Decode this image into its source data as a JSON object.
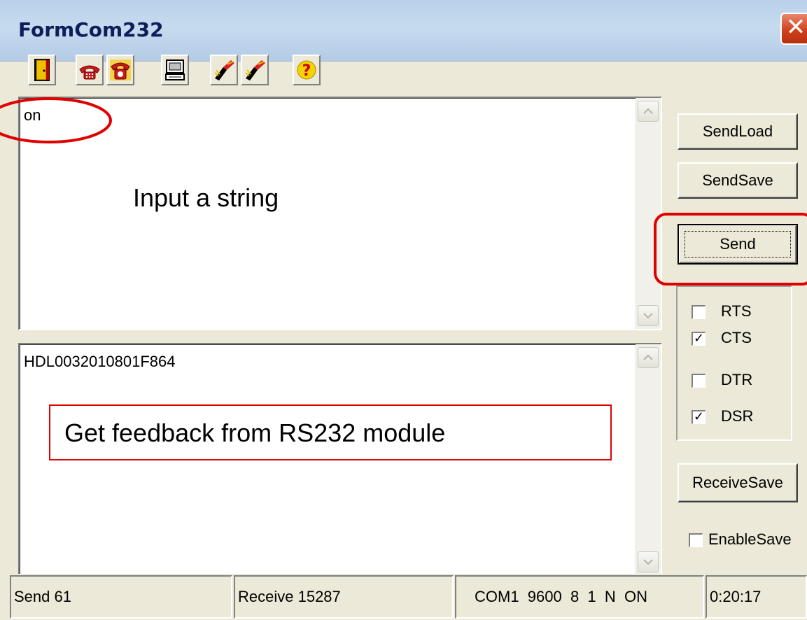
{
  "window": {
    "title": "FormCom232",
    "close_glyph": "✕"
  },
  "toolbar": {
    "buttons": [
      {
        "icon": "exit-door-icon"
      },
      {
        "icon": "telephone-hangup-icon"
      },
      {
        "icon": "telephone-dial-icon"
      },
      {
        "icon": "computer-terminal-icon"
      },
      {
        "icon": "clear-send-icon"
      },
      {
        "icon": "clear-receive-icon"
      },
      {
        "icon": "help-icon",
        "glyph": "?"
      }
    ]
  },
  "send_memo": {
    "value": "on"
  },
  "receive_memo": {
    "value": "HDL0032010801F864"
  },
  "annotations": {
    "input_hint": "Input a string",
    "feedback_hint": "Get feedback from RS232 module",
    "highlight_color": "#e00000"
  },
  "buttons": {
    "send_load": "SendLoad",
    "send_save": "SendSave",
    "send": "Send",
    "receive_save": "ReceiveSave"
  },
  "signals": [
    {
      "label": "RTS",
      "checked": false
    },
    {
      "label": "CTS",
      "checked": true
    },
    {
      "label": "DTR",
      "checked": false
    },
    {
      "label": "DSR",
      "checked": true
    }
  ],
  "enable_save": {
    "label": "EnableSave",
    "checked": false
  },
  "statusbar": {
    "send": "Send 61",
    "receive": "Receive 15287",
    "port": "COM1  9600  8  1  N  ON",
    "time": "0:20:17"
  },
  "colors": {
    "face": "#ece9d8",
    "title_text": "#0d1f5a",
    "close": "#d1411d"
  }
}
